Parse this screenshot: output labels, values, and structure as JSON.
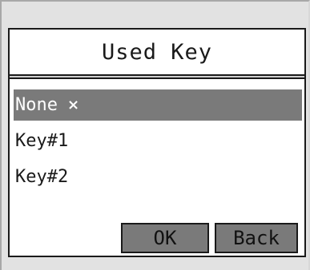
{
  "dialog": {
    "title": "Used Key",
    "items": [
      {
        "label": "None",
        "selected": true,
        "close_glyph": "×"
      },
      {
        "label": "Key#1",
        "selected": false
      },
      {
        "label": "Key#2",
        "selected": false
      }
    ],
    "buttons": {
      "ok_label": "OK",
      "back_label": "Back"
    }
  },
  "colors": {
    "background": "#e2e2e2",
    "dialog_bg": "#ffffff",
    "selection": "#7a7a7a",
    "button_bg": "#7a7a7a",
    "border": "#1a1a1a"
  }
}
